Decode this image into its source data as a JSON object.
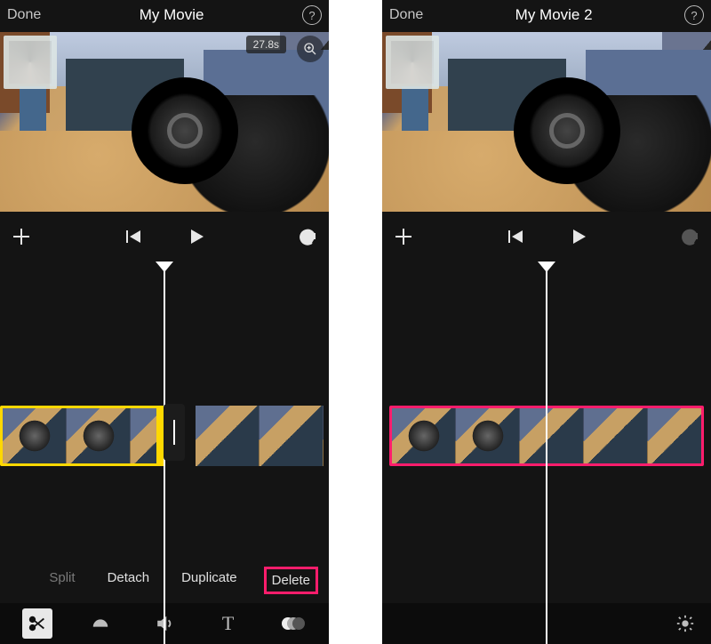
{
  "left": {
    "header": {
      "done": "Done",
      "title": "My Movie",
      "help": "?"
    },
    "preview": {
      "time_badge": "27.8s"
    },
    "actions": {
      "split": "Split",
      "detach": "Detach",
      "duplicate": "Duplicate",
      "delete": "Delete"
    }
  },
  "right": {
    "header": {
      "done": "Done",
      "title": "My Movie 2",
      "help": "?"
    }
  },
  "icons": {
    "help": "help-icon",
    "zoom": "magnifier-plus-icon",
    "add": "plus-icon",
    "skip_back": "skip-back-icon",
    "play": "play-icon",
    "undo": "undo-icon",
    "scissors": "scissors-icon",
    "speedometer": "speedometer-icon",
    "volume": "volume-icon",
    "text_tool": "T",
    "filters": "filters-icon",
    "settings": "gear-icon"
  }
}
